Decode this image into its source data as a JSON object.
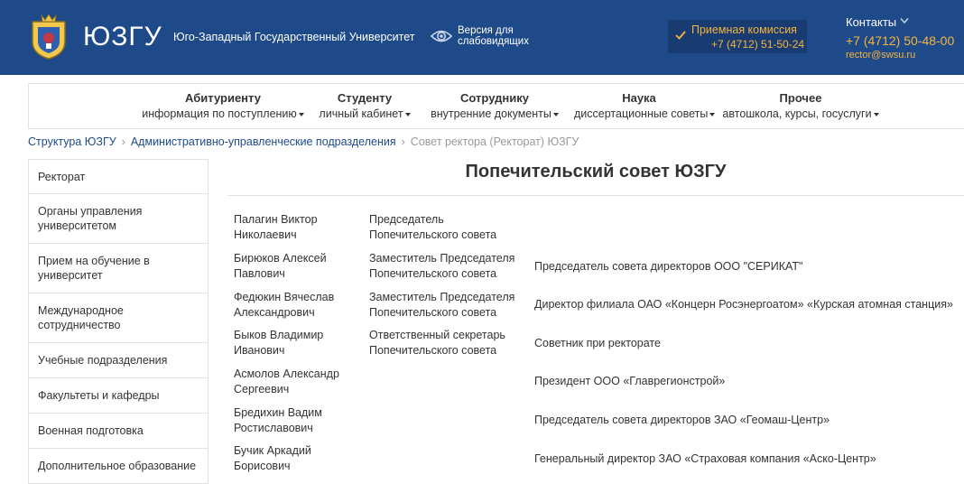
{
  "header": {
    "brand": "ЮЗГУ",
    "full_name": "Юго-Западный Государственный Университет",
    "vision_line1": "Версия для",
    "vision_line2": "слабовидящих",
    "admission_title": "Приемная комиссия",
    "admission_phone": "+7 (4712) 51-50-24",
    "contacts_label": "Контакты",
    "contacts_phone": "+7 (4712) 50-48-00",
    "contacts_email": "rector@swsu.ru",
    "colors": {
      "bar": "#1e4a8a",
      "accent": "#f5b53d"
    }
  },
  "nav": [
    {
      "title": "Абитуриенту",
      "sub": "информация по поступлению"
    },
    {
      "title": "Студенту",
      "sub": "личный кабинет"
    },
    {
      "title": "Сотруднику",
      "sub": "внутренние документы"
    },
    {
      "title": "Наука",
      "sub": "диссертационные советы"
    },
    {
      "title": "Прочее",
      "sub": "автошкола, курсы, госуслуги"
    }
  ],
  "breadcrumb": {
    "items": [
      "Структура ЮЗГУ",
      "Административно-управленческие подразделения"
    ],
    "current": "Совет ректора (Ректорат) ЮЗГУ"
  },
  "sidebar": [
    {
      "label": "Ректорат"
    },
    {
      "label": "Органы управления университетом"
    },
    {
      "label": "Прием на обучение в университет"
    },
    {
      "label": "Международное сотрудничество"
    },
    {
      "label": "Учебные подразделения"
    },
    {
      "label": "Факультеты и кафедры"
    },
    {
      "label": "Военная подготовка"
    },
    {
      "label": "Дополнительное образование"
    }
  ],
  "main": {
    "title": "Попечительский совет ЮЗГУ",
    "members": [
      {
        "name": "Палагин Виктор Николаевич",
        "role": "Председатель Попечительского совета",
        "job": ""
      },
      {
        "name": "Бирюков Алексей Павлович",
        "role": "Заместитель Председателя Попечительского совета",
        "job": "Председатель совета директоров ООО \"СЕРИКАТ\""
      },
      {
        "name": "Федюкин Вячеслав Александрович",
        "role": "Заместитель Председателя Попечительского совета",
        "job": "Директор филиала ОАО «Концерн Росэнергоатом» «Курская атомная станция»"
      },
      {
        "name": "Быков Владимир Иванович",
        "role": "Ответственный секретарь Попечительского совета",
        "job": "Советник при ректорате"
      },
      {
        "name": "Асмолов Александр Сергеевич",
        "role": "",
        "job": "Президент ООО «Главрегионстрой»"
      },
      {
        "name": "Бредихин Вадим Ростиславович",
        "role": "",
        "job": "Председатель совета директоров ЗАО «Геомаш-Центр»"
      },
      {
        "name": "Бучик Аркадий Борисович",
        "role": "",
        "job": "Генеральный директор ЗАО «Страховая компания «Аско-Центр»"
      }
    ]
  }
}
